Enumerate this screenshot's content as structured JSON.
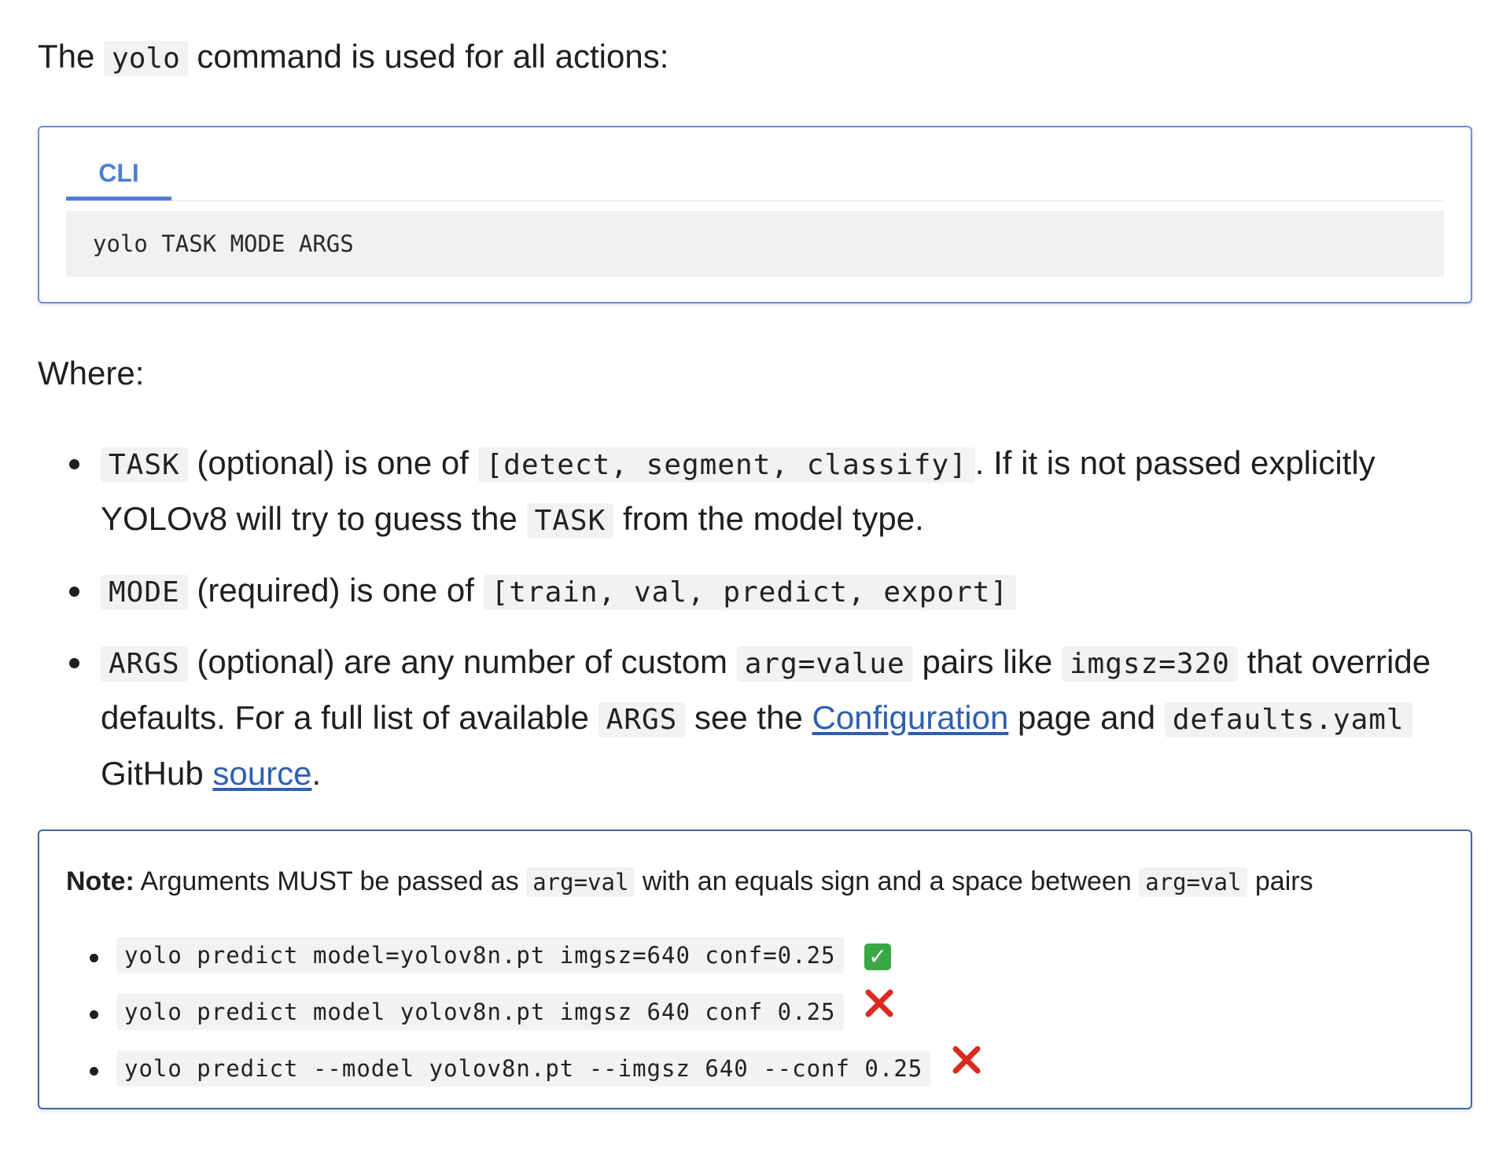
{
  "intro": {
    "before": "The",
    "code": "yolo",
    "after": "command is used for all actions:"
  },
  "cli_block": {
    "tab_label": "CLI",
    "code": "yolo TASK MODE ARGS"
  },
  "where_label": "Where:",
  "args_list": [
    {
      "code": "TASK",
      "text1": "(optional) is one of",
      "code2": "[detect, segment, classify]",
      "text2": ". If it is not passed explicitly YOLOv8 will try to guess the",
      "code3": "TASK",
      "text3": "from the model type."
    },
    {
      "code": "MODE",
      "text1": "(required) is one of",
      "code2": "[train, val, predict, export]"
    },
    {
      "code": "ARGS",
      "text1": "(optional) are any number of custom",
      "code2": "arg=value",
      "text2": "pairs like",
      "code3": "imgsz=320",
      "text3": "that override defaults. For a full list of available",
      "code4": "ARGS",
      "text4": "see the",
      "link1": "Configuration",
      "text5": "page and",
      "code5": "defaults.yaml",
      "text6": "GitHub",
      "link2": "source",
      "text7": "."
    }
  ],
  "note": {
    "label": "Note:",
    "text1": "Arguments MUST be passed as",
    "code1": "arg=val",
    "text2": "with an equals sign and a space between",
    "code2": "arg=val",
    "text3": "pairs",
    "examples": [
      {
        "code": "yolo predict model=yolov8n.pt imgsz=640 conf=0.25",
        "status": "check-mark-icon",
        "status_color": "#3aa845"
      },
      {
        "code": "yolo predict model yolov8n.pt imgsz 640 conf 0.25",
        "status": "cross-mark-icon",
        "status_color": "#d92b1f"
      },
      {
        "code": "yolo predict --model yolov8n.pt --imgsz 640 --conf 0.25",
        "status": "cross-mark-icon",
        "status_color": "#d92b1f"
      }
    ]
  },
  "colors": {
    "tab_accent": "#4f7fd4",
    "link": "#2f5fb0",
    "note_border": "#3a6aa8"
  }
}
